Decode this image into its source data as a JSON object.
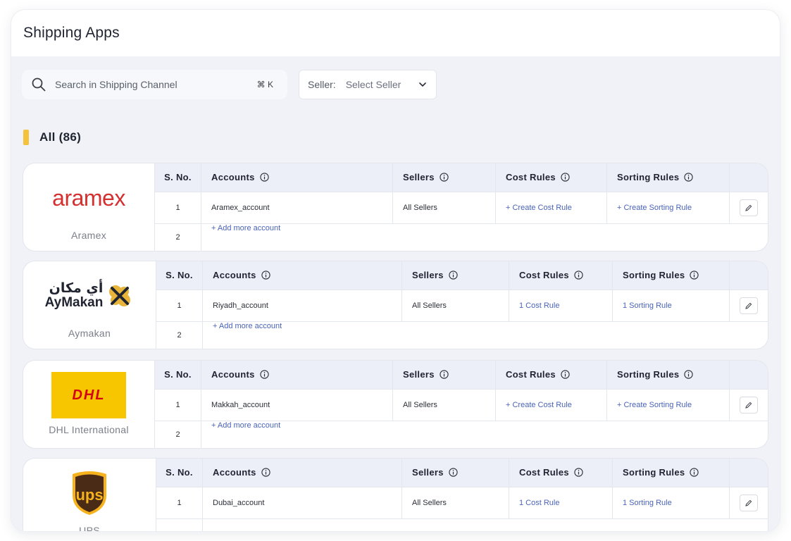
{
  "page": {
    "title": "Shipping Apps"
  },
  "search": {
    "placeholder": "Search in Shipping Channel",
    "shortcut": "⌘ K"
  },
  "seller_filter": {
    "label": "Seller:",
    "value": "Select Seller"
  },
  "section": {
    "title": "All (86)"
  },
  "table_headers": {
    "sno": "S. No.",
    "accounts": "Accounts",
    "sellers": "Sellers",
    "cost_rules": "Cost Rules",
    "sorting_rules": "Sorting Rules"
  },
  "apps": [
    {
      "name": "Aramex",
      "logo_text": "aramex",
      "row1": {
        "sno": "1",
        "account": "Aramex_account",
        "sellers": "All Sellers",
        "cost": "+ Create Cost Rule",
        "sort": "+ Create Sorting Rule"
      },
      "row2": {
        "sno": "2",
        "add": "+ Add more account"
      }
    },
    {
      "name": "Aymakan",
      "logo_text": "AyMakan",
      "logo_arabic": "أي مكان",
      "row1": {
        "sno": "1",
        "account": "Riyadh_account",
        "sellers": "All Sellers",
        "cost": "1 Cost Rule",
        "sort": "1 Sorting Rule"
      },
      "row2": {
        "sno": "2",
        "add": "+ Add more account"
      }
    },
    {
      "name": "DHL International",
      "logo_text": "DHL",
      "row1": {
        "sno": "1",
        "account": "Makkah_account",
        "sellers": "All Sellers",
        "cost": "+ Create Cost Rule",
        "sort": "+ Create Sorting Rule"
      },
      "row2": {
        "sno": "2",
        "add": "+ Add more account"
      }
    },
    {
      "name": "UPS",
      "logo_text": "ups",
      "row1": {
        "sno": "1",
        "account": "Dubai_account",
        "sellers": "All Sellers",
        "cost": "1 Cost Rule",
        "sort": "1 Sorting Rule"
      }
    }
  ],
  "colors": {
    "accent": "#f5c33b",
    "link": "#4a63b8",
    "aramex": "#d3302f",
    "dhl_yellow": "#f7c600",
    "dhl_red": "#d40511",
    "ups_brown": "#4a2b16",
    "ups_gold": "#f6b31d"
  }
}
